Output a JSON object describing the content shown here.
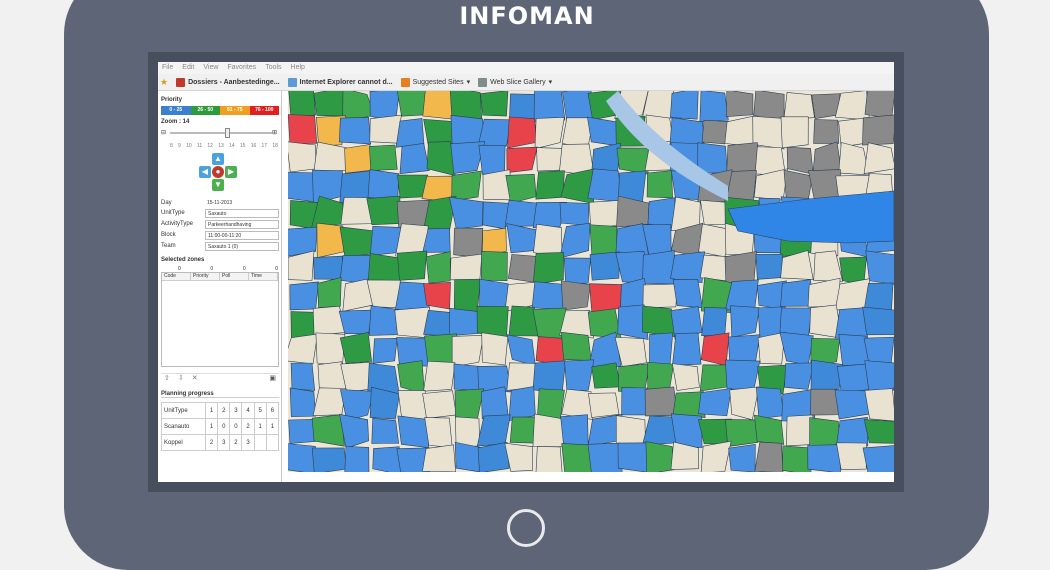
{
  "brand": "INFOMAN",
  "browser": {
    "menu": [
      "File",
      "Edit",
      "View",
      "Favorites",
      "Tools",
      "Help"
    ],
    "favorites": [
      {
        "label": "Dossiers - Aanbestedinge...",
        "icon": "dossier-icon",
        "color": "#c0392b"
      },
      {
        "label": "Internet Explorer cannot d...",
        "icon": "ie-page-icon",
        "color": "#5b9bd5"
      },
      {
        "label": "Suggested Sites",
        "icon": "suggested-sites-icon",
        "color": "#e67e22"
      },
      {
        "label": "Web Slice Gallery",
        "icon": "web-slice-icon",
        "color": "#7f8c8d"
      }
    ]
  },
  "sidebar": {
    "priority_label": "Priority",
    "priority_buckets": [
      {
        "label": "0 - 25",
        "color": "#3a7fd0"
      },
      {
        "label": "26 - 50",
        "color": "#2e9a3e"
      },
      {
        "label": "51 - 75",
        "color": "#f0a020"
      },
      {
        "label": "76 - 100",
        "color": "#e02020"
      }
    ],
    "zoom_label": "Zoom : 14",
    "zoom_ticks": [
      "8",
      "9",
      "10",
      "11",
      "12",
      "13",
      "14",
      "15",
      "16",
      "17",
      "18"
    ],
    "fields": [
      {
        "label": "Day",
        "value": "15-11-2013"
      },
      {
        "label": "UnitType",
        "value": "Saxauto"
      },
      {
        "label": "ActivityType",
        "value": "Parkeerhandhaving"
      },
      {
        "label": "Block",
        "value": "11:00-00-11:20"
      },
      {
        "label": "Team",
        "value": "Saxauto 1 (0)"
      }
    ],
    "selected_label": "Selected zones",
    "selected_counts": [
      "0",
      "0",
      "0",
      "0"
    ],
    "selected_columns": [
      "Code",
      "Priority",
      "Poll",
      "Time"
    ],
    "planning_title": "Planning progress",
    "planning_header": [
      "UnitType",
      "1",
      "2",
      "3",
      "4",
      "5",
      "6"
    ],
    "planning_rows": [
      {
        "name": "Scanauto",
        "values": [
          "1",
          "0",
          "0",
          "2",
          "1",
          "1"
        ]
      },
      {
        "name": "Koppel",
        "values": [
          "2",
          "3",
          "2",
          "3",
          "",
          ""
        ]
      }
    ]
  },
  "map": {
    "palette": [
      "#4a90e2",
      "#3f8ad8",
      "#2f9a44",
      "#41a84f",
      "#e9e2d0",
      "#f2b84b",
      "#e8424a",
      "#8a8a8a"
    ],
    "water_color": "#a8c6e6"
  }
}
